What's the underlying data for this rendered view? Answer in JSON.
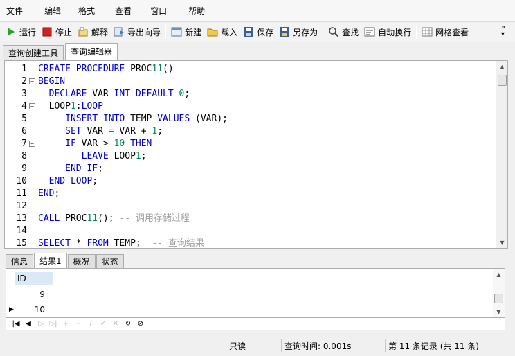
{
  "menu": [
    "文件",
    "编辑",
    "格式",
    "查看",
    "窗口",
    "帮助"
  ],
  "toolbar": {
    "run": "运行",
    "stop": "停止",
    "explain": "解释",
    "export_wizard": "导出向导",
    "new": "新建",
    "load": "载入",
    "save": "保存",
    "save_as": "另存为",
    "find": "查找",
    "word_wrap": "自动换行",
    "grid_view": "网格查看"
  },
  "top_tabs": [
    "查询创建工具",
    "查询编辑器"
  ],
  "editor": {
    "line_numbers": [
      "1",
      "2",
      "3",
      "4",
      "5",
      "6",
      "7",
      "8",
      "9",
      "10",
      "11",
      "12",
      "13",
      "14",
      "15"
    ],
    "lines": [
      "CREATE PROCEDURE PROC11()",
      "BEGIN",
      "  DECLARE VAR INT DEFAULT 0;",
      "  LOOP1:LOOP",
      "     INSERT INTO TEMP VALUES (VAR);",
      "     SET VAR = VAR + 1;",
      "     IF VAR > 10 THEN",
      "        LEAVE LOOP1;",
      "     END IF;",
      "  END LOOP;",
      "END;",
      "",
      "CALL PROC11(); -- 调用存储过程",
      "",
      "SELECT * FROM TEMP;  -- 查询结果"
    ]
  },
  "bottom_tabs": [
    "信息",
    "结果1",
    "概况",
    "状态"
  ],
  "result": {
    "column": "ID",
    "rows": [
      "9",
      "10"
    ]
  },
  "status": {
    "mode": "只读",
    "query_time": "查询时间: 0.001s",
    "record": "第 11 条记录 (共 11 条)"
  },
  "colors": {
    "keyword": "#0000c8",
    "number": "#098658",
    "comment": "#a0a0a0",
    "run_icon": "#2ca02c",
    "stop_icon": "#d62020"
  }
}
